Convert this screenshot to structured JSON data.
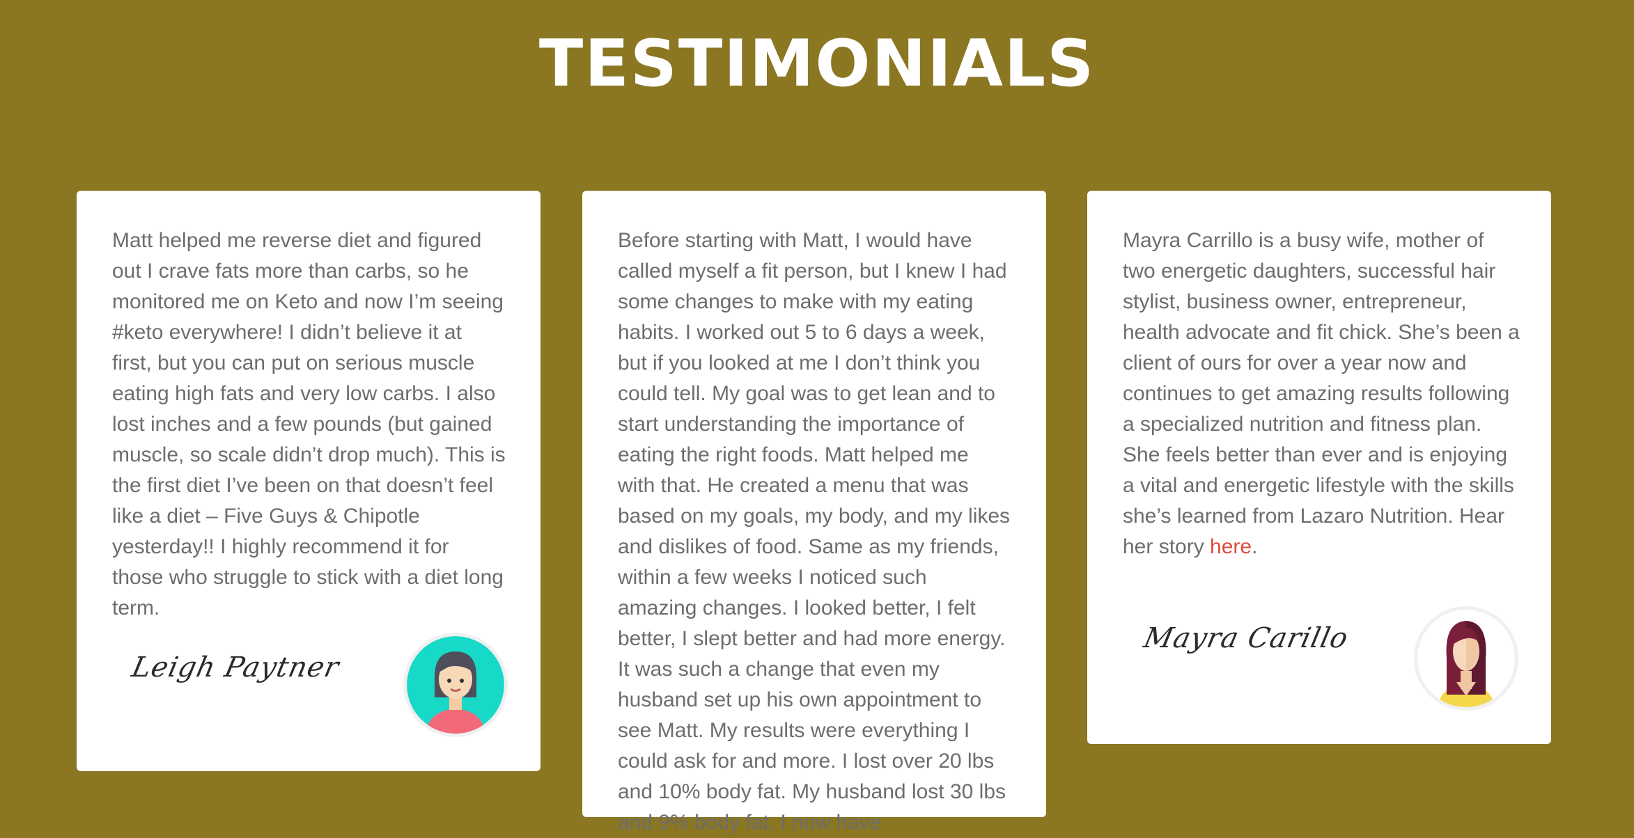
{
  "section": {
    "title": "TESTIMONIALS"
  },
  "testimonials": [
    {
      "text": "Matt helped me reverse diet and figured out I crave fats more than carbs, so he monitored me on Keto and now I’m seeing #keto everywhere! I didn’t believe it at first, but you can put on serious muscle eating high fats and very low carbs. I also lost inches and a few pounds (but gained muscle, so scale didn’t drop much). This is the first diet I’ve been on that doesn’t feel like a diet – Five Guys & Chipotle yesterday!! I highly recommend it for those who struggle to stick with a diet long term.",
      "signature": "Leigh Paytner",
      "avatar_icon": "woman-teal-avatar-icon"
    },
    {
      "text": "Before starting with Matt, I would have called myself a fit person, but I knew I had some changes to make with my eating habits. I worked out 5 to 6 days a week, but if you looked at me I don’t think you could tell. My goal was to get lean and to start understanding the importance of eating the right foods. Matt helped me with that. He created a menu that was based on my goals, my body, and my likes and dislikes of food. Same as my friends, within a few weeks I noticed such amazing changes. I looked better, I felt better, I slept better and had more energy. It was such a change that even my husband set up his own appointment to see Matt. My results were everything I could ask for and more. I lost over 20 lbs and 10% body fat. My husband lost 30 lbs and 9% body fat. I now have"
    },
    {
      "text": "Mayra Carrillo is a busy wife, mother of two energetic daughters, successful hair stylist, business owner, entrepreneur, health advocate and fit chick. She’s been a client of ours for over a year now and continues to get amazing results following a specialized nutrition and fitness plan. She feels better than ever and is enjoying a vital and energetic lifestyle with the skills she’s learned from Lazaro Nutrition. Hear her story ",
      "link_text": "here",
      "text_end": ".",
      "signature": "Mayra Carillo",
      "avatar_icon": "woman-dark-hair-avatar-icon"
    }
  ],
  "colors": {
    "background": "#8b7622",
    "card": "#ffffff",
    "body_text": "#6d6d6d",
    "link": "#e04b3a"
  }
}
